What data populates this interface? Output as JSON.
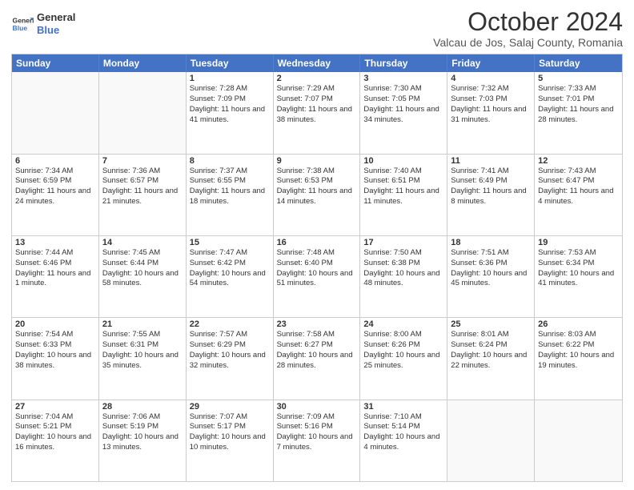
{
  "header": {
    "logo_line1": "General",
    "logo_line2": "Blue",
    "month_title": "October 2024",
    "location": "Valcau de Jos, Salaj County, Romania"
  },
  "weekdays": [
    "Sunday",
    "Monday",
    "Tuesday",
    "Wednesday",
    "Thursday",
    "Friday",
    "Saturday"
  ],
  "weeks": [
    [
      {
        "day": "",
        "sunrise": "",
        "sunset": "",
        "daylight": "",
        "empty": true
      },
      {
        "day": "",
        "sunrise": "",
        "sunset": "",
        "daylight": "",
        "empty": true
      },
      {
        "day": "1",
        "sunrise": "Sunrise: 7:28 AM",
        "sunset": "Sunset: 7:09 PM",
        "daylight": "Daylight: 11 hours and 41 minutes."
      },
      {
        "day": "2",
        "sunrise": "Sunrise: 7:29 AM",
        "sunset": "Sunset: 7:07 PM",
        "daylight": "Daylight: 11 hours and 38 minutes."
      },
      {
        "day": "3",
        "sunrise": "Sunrise: 7:30 AM",
        "sunset": "Sunset: 7:05 PM",
        "daylight": "Daylight: 11 hours and 34 minutes."
      },
      {
        "day": "4",
        "sunrise": "Sunrise: 7:32 AM",
        "sunset": "Sunset: 7:03 PM",
        "daylight": "Daylight: 11 hours and 31 minutes."
      },
      {
        "day": "5",
        "sunrise": "Sunrise: 7:33 AM",
        "sunset": "Sunset: 7:01 PM",
        "daylight": "Daylight: 11 hours and 28 minutes."
      }
    ],
    [
      {
        "day": "6",
        "sunrise": "Sunrise: 7:34 AM",
        "sunset": "Sunset: 6:59 PM",
        "daylight": "Daylight: 11 hours and 24 minutes."
      },
      {
        "day": "7",
        "sunrise": "Sunrise: 7:36 AM",
        "sunset": "Sunset: 6:57 PM",
        "daylight": "Daylight: 11 hours and 21 minutes."
      },
      {
        "day": "8",
        "sunrise": "Sunrise: 7:37 AM",
        "sunset": "Sunset: 6:55 PM",
        "daylight": "Daylight: 11 hours and 18 minutes."
      },
      {
        "day": "9",
        "sunrise": "Sunrise: 7:38 AM",
        "sunset": "Sunset: 6:53 PM",
        "daylight": "Daylight: 11 hours and 14 minutes."
      },
      {
        "day": "10",
        "sunrise": "Sunrise: 7:40 AM",
        "sunset": "Sunset: 6:51 PM",
        "daylight": "Daylight: 11 hours and 11 minutes."
      },
      {
        "day": "11",
        "sunrise": "Sunrise: 7:41 AM",
        "sunset": "Sunset: 6:49 PM",
        "daylight": "Daylight: 11 hours and 8 minutes."
      },
      {
        "day": "12",
        "sunrise": "Sunrise: 7:43 AM",
        "sunset": "Sunset: 6:47 PM",
        "daylight": "Daylight: 11 hours and 4 minutes."
      }
    ],
    [
      {
        "day": "13",
        "sunrise": "Sunrise: 7:44 AM",
        "sunset": "Sunset: 6:46 PM",
        "daylight": "Daylight: 11 hours and 1 minute."
      },
      {
        "day": "14",
        "sunrise": "Sunrise: 7:45 AM",
        "sunset": "Sunset: 6:44 PM",
        "daylight": "Daylight: 10 hours and 58 minutes."
      },
      {
        "day": "15",
        "sunrise": "Sunrise: 7:47 AM",
        "sunset": "Sunset: 6:42 PM",
        "daylight": "Daylight: 10 hours and 54 minutes."
      },
      {
        "day": "16",
        "sunrise": "Sunrise: 7:48 AM",
        "sunset": "Sunset: 6:40 PM",
        "daylight": "Daylight: 10 hours and 51 minutes."
      },
      {
        "day": "17",
        "sunrise": "Sunrise: 7:50 AM",
        "sunset": "Sunset: 6:38 PM",
        "daylight": "Daylight: 10 hours and 48 minutes."
      },
      {
        "day": "18",
        "sunrise": "Sunrise: 7:51 AM",
        "sunset": "Sunset: 6:36 PM",
        "daylight": "Daylight: 10 hours and 45 minutes."
      },
      {
        "day": "19",
        "sunrise": "Sunrise: 7:53 AM",
        "sunset": "Sunset: 6:34 PM",
        "daylight": "Daylight: 10 hours and 41 minutes."
      }
    ],
    [
      {
        "day": "20",
        "sunrise": "Sunrise: 7:54 AM",
        "sunset": "Sunset: 6:33 PM",
        "daylight": "Daylight: 10 hours and 38 minutes."
      },
      {
        "day": "21",
        "sunrise": "Sunrise: 7:55 AM",
        "sunset": "Sunset: 6:31 PM",
        "daylight": "Daylight: 10 hours and 35 minutes."
      },
      {
        "day": "22",
        "sunrise": "Sunrise: 7:57 AM",
        "sunset": "Sunset: 6:29 PM",
        "daylight": "Daylight: 10 hours and 32 minutes."
      },
      {
        "day": "23",
        "sunrise": "Sunrise: 7:58 AM",
        "sunset": "Sunset: 6:27 PM",
        "daylight": "Daylight: 10 hours and 28 minutes."
      },
      {
        "day": "24",
        "sunrise": "Sunrise: 8:00 AM",
        "sunset": "Sunset: 6:26 PM",
        "daylight": "Daylight: 10 hours and 25 minutes."
      },
      {
        "day": "25",
        "sunrise": "Sunrise: 8:01 AM",
        "sunset": "Sunset: 6:24 PM",
        "daylight": "Daylight: 10 hours and 22 minutes."
      },
      {
        "day": "26",
        "sunrise": "Sunrise: 8:03 AM",
        "sunset": "Sunset: 6:22 PM",
        "daylight": "Daylight: 10 hours and 19 minutes."
      }
    ],
    [
      {
        "day": "27",
        "sunrise": "Sunrise: 7:04 AM",
        "sunset": "Sunset: 5:21 PM",
        "daylight": "Daylight: 10 hours and 16 minutes."
      },
      {
        "day": "28",
        "sunrise": "Sunrise: 7:06 AM",
        "sunset": "Sunset: 5:19 PM",
        "daylight": "Daylight: 10 hours and 13 minutes."
      },
      {
        "day": "29",
        "sunrise": "Sunrise: 7:07 AM",
        "sunset": "Sunset: 5:17 PM",
        "daylight": "Daylight: 10 hours and 10 minutes."
      },
      {
        "day": "30",
        "sunrise": "Sunrise: 7:09 AM",
        "sunset": "Sunset: 5:16 PM",
        "daylight": "Daylight: 10 hours and 7 minutes."
      },
      {
        "day": "31",
        "sunrise": "Sunrise: 7:10 AM",
        "sunset": "Sunset: 5:14 PM",
        "daylight": "Daylight: 10 hours and 4 minutes."
      },
      {
        "day": "",
        "sunrise": "",
        "sunset": "",
        "daylight": "",
        "empty": true
      },
      {
        "day": "",
        "sunrise": "",
        "sunset": "",
        "daylight": "",
        "empty": true
      }
    ]
  ]
}
